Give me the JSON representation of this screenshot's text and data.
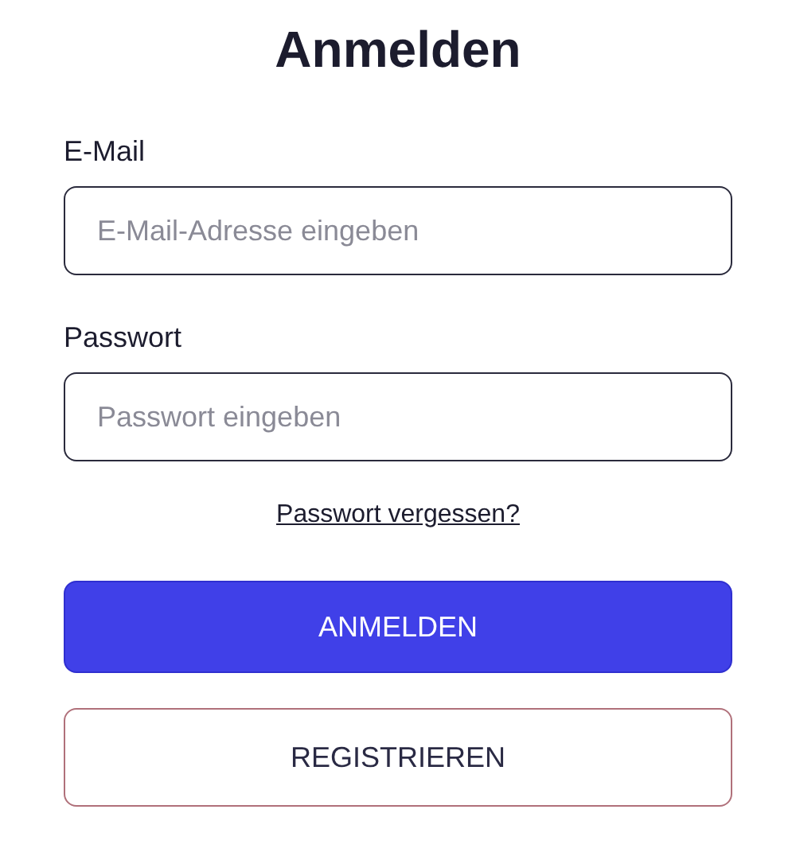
{
  "title": "Anmelden",
  "fields": [
    {
      "label": "E-Mail",
      "placeholder": "E-Mail-Adresse eingeben"
    },
    {
      "label": "Passwort",
      "placeholder": "Passwort eingeben"
    }
  ],
  "forgot_link": "Passwort vergessen?",
  "buttons": [
    {
      "label": "ANMELDEN",
      "kind": "primary"
    },
    {
      "label": "REGISTRIEREN",
      "kind": "secondary"
    }
  ]
}
